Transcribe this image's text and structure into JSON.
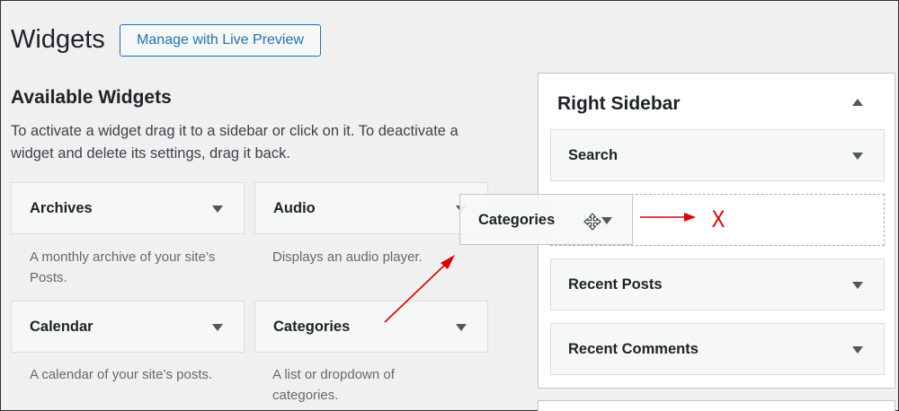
{
  "header": {
    "title": "Widgets",
    "preview_button": "Manage with Live Preview"
  },
  "available": {
    "title": "Available Widgets",
    "description": "To activate a widget drag it to a sidebar or click on it. To deactivate a widget and delete its settings, drag it back.",
    "widgets": [
      {
        "name": "Archives",
        "desc": "A monthly archive of your site’s Posts."
      },
      {
        "name": "Audio",
        "desc": "Displays an audio player."
      },
      {
        "name": "Calendar",
        "desc": "A calendar of your site’s posts."
      },
      {
        "name": "Categories",
        "desc": "A list or dropdown of categories."
      }
    ]
  },
  "sidebar": {
    "title": "Right Sidebar",
    "widgets": [
      {
        "name": "Search"
      },
      {
        "name": "Recent Posts"
      },
      {
        "name": "Recent Comments"
      }
    ]
  },
  "dragging": {
    "name": "Categories"
  },
  "annotation": {
    "mark": "X",
    "color": "#e00000"
  },
  "colors": {
    "accent": "#2271b1",
    "background": "#f0f0f1"
  }
}
